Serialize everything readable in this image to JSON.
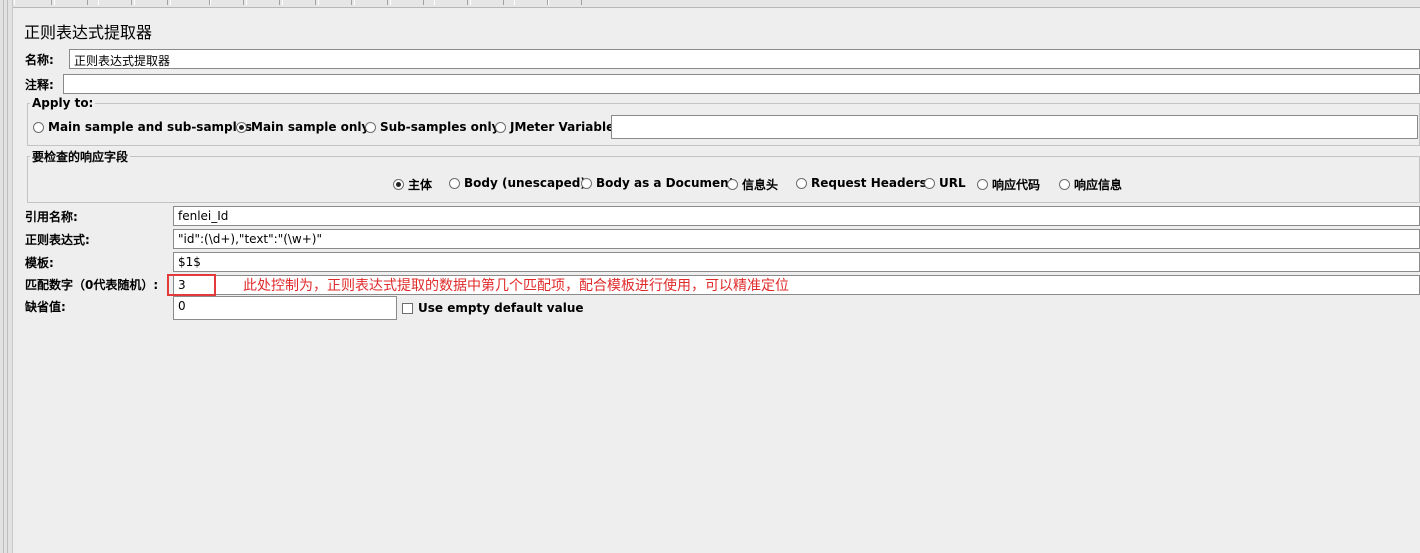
{
  "header": {
    "title": "正则表达式提取器"
  },
  "name_field": {
    "label": "名称:",
    "value": "正则表达式提取器"
  },
  "comment_field": {
    "label": "注释:",
    "value": ""
  },
  "apply_to": {
    "legend": "Apply to:",
    "options": [
      {
        "label": "Main sample and sub-samples",
        "selected": false
      },
      {
        "label": "Main sample only",
        "selected": true
      },
      {
        "label": "Sub-samples only",
        "selected": false
      },
      {
        "label": "JMeter Variable",
        "selected": false
      }
    ],
    "variable_value": ""
  },
  "response_field": {
    "legend": "要检查的响应字段",
    "options": [
      {
        "label": "主体",
        "selected": true
      },
      {
        "label": "Body (unescaped)",
        "selected": false
      },
      {
        "label": "Body as a Document",
        "selected": false
      },
      {
        "label": "信息头",
        "selected": false
      },
      {
        "label": "Request Headers",
        "selected": false
      },
      {
        "label": "URL",
        "selected": false
      },
      {
        "label": "响应代码",
        "selected": false
      },
      {
        "label": "响应信息",
        "selected": false
      }
    ]
  },
  "reference_name": {
    "label": "引用名称:",
    "value": "fenlei_Id"
  },
  "regex": {
    "label": "正则表达式:",
    "value": "\"id\":(\\d+),\"text\":\"(\\w+)\""
  },
  "template": {
    "label": "模板:",
    "value": "$1$"
  },
  "match_no": {
    "label": "匹配数字（0代表随机）:",
    "value": "3"
  },
  "default_value": {
    "label": "缺省值:",
    "value": "0",
    "use_empty_label": "Use empty default value",
    "use_empty_checked": false
  },
  "annotation": {
    "text": "此处控制为，正则表达式提取的数据中第几个匹配项，配合模板进行使用，可以精准定位"
  }
}
